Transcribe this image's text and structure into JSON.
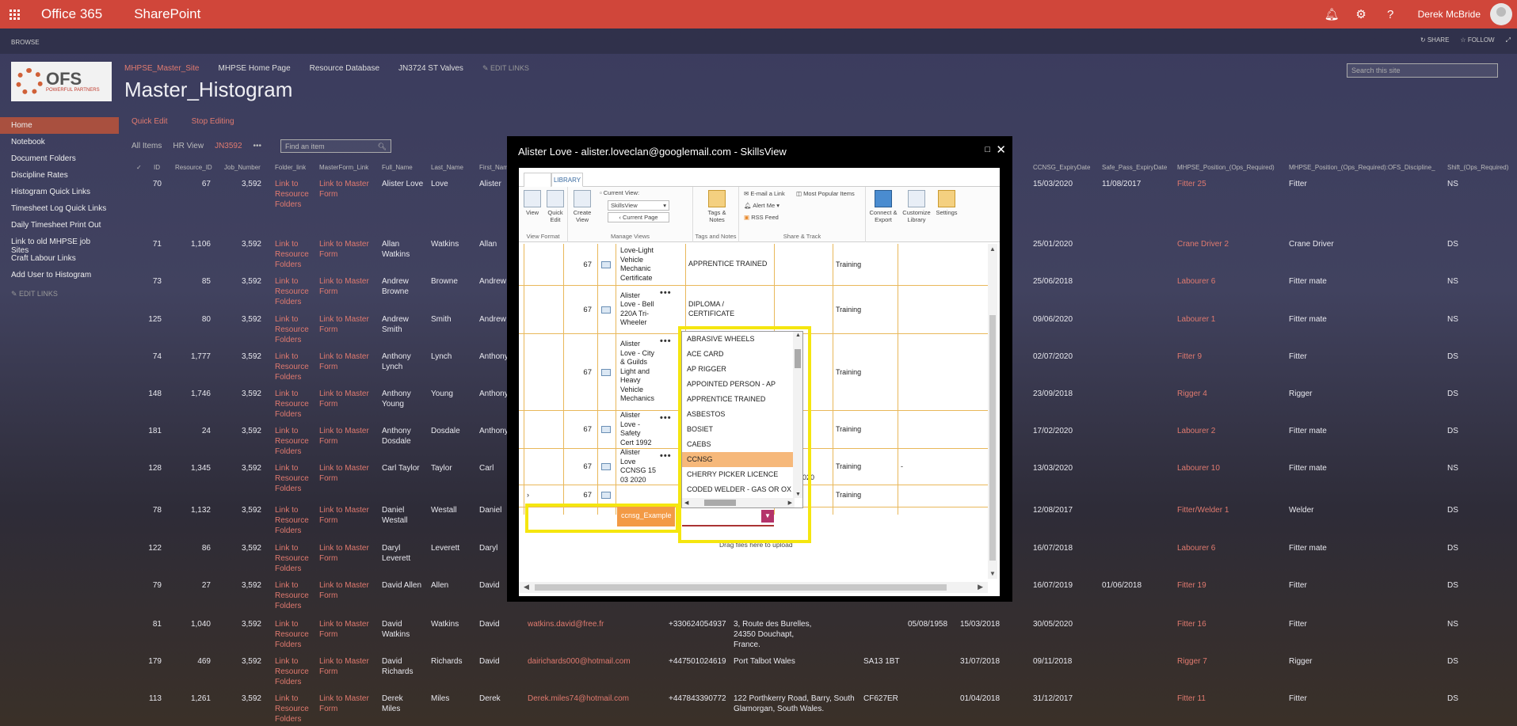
{
  "suite": {
    "brand": "Office 365",
    "app": "SharePoint",
    "user": "Derek McBride",
    "icons": [
      "bell-icon",
      "gear-icon",
      "help-icon"
    ],
    "accent": "#d0463a"
  },
  "ribbonbar": {
    "browse": "BROWSE",
    "share": "SHARE",
    "follow": "FOLLOW"
  },
  "logo": {
    "big": "OFS",
    "small": "POWERFUL PARTNERS"
  },
  "topnav": {
    "items": [
      "MHPSE_Master_Site",
      "MHPSE Home Page",
      "Resource Database",
      "JN3724 ST Valves"
    ],
    "edit_links": "EDIT LINKS"
  },
  "page_title": "Master_Histogram",
  "search": {
    "placeholder": "Search this site"
  },
  "quicklaunch": {
    "items": [
      "Home",
      "Notebook",
      "Document Folders",
      "Discipline Rates",
      "Histogram Quick Links",
      "Timesheet Log Quick Links",
      "Daily Timesheet Print Out",
      "Link to old MHPSE job Sites",
      "Craft Labour Links",
      "Add User to Histogram"
    ],
    "edit_links": "EDIT LINKS"
  },
  "commands": {
    "quick_edit": "Quick Edit",
    "stop_editing": "Stop Editing"
  },
  "views": {
    "all": "All Items",
    "hr": "HR View",
    "current": "JN3592",
    "more": "•••",
    "find_placeholder": "Find an item"
  },
  "columns": {
    "check": "✓",
    "id": "ID",
    "resource_id": "Resource_ID",
    "job_number": "Job_Number",
    "folder_link": "Folder_link",
    "masterform_link": "MasterForm_Link",
    "full_name": "Full_Name",
    "last_name": "Last_Name",
    "first_name": "First_Nam",
    "ccnsg_expiry": "CCNSG_ExpiryDate",
    "safe_pass_expiry": "Safe_Pass_ExpiryDate",
    "position_ops": "MHPSE_Position_(Ops_Required)",
    "position_disc": "MHPSE_Position_(Ops_Required):OFS_Discipline_",
    "shift": "Shift_(Ops_Required)"
  },
  "rows": [
    {
      "id": "70",
      "res": "67",
      "job": "3,592",
      "folder": [
        "Link to",
        "Resource",
        "Folders"
      ],
      "master": [
        "Link to Master",
        "Form"
      ],
      "full": [
        "Alister Love"
      ],
      "last": "Love",
      "first": "Alister",
      "email": "",
      "phone": "",
      "addr": [],
      "post": "",
      "dob": "",
      "cscs": "",
      "ccnsg": "15/03/2020",
      "safe": "11/08/2017",
      "pos": "Fitter 25",
      "disc": "Fitter",
      "shift": "NS"
    },
    {
      "id": "71",
      "res": "1,106",
      "job": "3,592",
      "folder": [
        "Link to",
        "Resource",
        "Folders"
      ],
      "master": [
        "Link to Master",
        "Form"
      ],
      "full": [
        "Allan",
        "Watkins"
      ],
      "last": "Watkins",
      "first": "Allan",
      "email": "",
      "phone": "",
      "addr": [],
      "post": "",
      "dob": "",
      "cscs": "",
      "ccnsg": "25/01/2020",
      "safe": "",
      "pos": "Crane Driver 2",
      "disc": "Crane Driver",
      "shift": "DS"
    },
    {
      "id": "73",
      "res": "85",
      "job": "3,592",
      "folder": [
        "Link to",
        "Resource",
        "Folders"
      ],
      "master": [
        "Link to Master",
        "Form"
      ],
      "full": [
        "Andrew",
        "Browne"
      ],
      "last": "Browne",
      "first": "Andrew",
      "email": "",
      "phone": "",
      "addr": [],
      "post": "",
      "dob": "",
      "cscs": "",
      "ccnsg": "25/06/2018",
      "safe": "",
      "pos": "Labourer 6",
      "disc": "Fitter mate",
      "shift": "NS"
    },
    {
      "id": "125",
      "res": "80",
      "job": "3,592",
      "folder": [
        "Link to",
        "Resource",
        "Folders"
      ],
      "master": [
        "Link to Master",
        "Form"
      ],
      "full": [
        "Andrew",
        "Smith"
      ],
      "last": "Smith",
      "first": "Andrew",
      "email": "",
      "phone": "",
      "addr": [],
      "post": "",
      "dob": "",
      "cscs": "",
      "ccnsg": "09/06/2020",
      "safe": "",
      "pos": "Labourer 1",
      "disc": "Fitter mate",
      "shift": "NS"
    },
    {
      "id": "74",
      "res": "1,777",
      "job": "3,592",
      "folder": [
        "Link to",
        "Resource",
        "Folders"
      ],
      "master": [
        "Link to Master",
        "Form"
      ],
      "full": [
        "Anthony",
        "Lynch"
      ],
      "last": "Lynch",
      "first": "Anthony",
      "email": "",
      "phone": "",
      "addr": [],
      "post": "",
      "dob": "",
      "cscs": "",
      "ccnsg": "02/07/2020",
      "safe": "",
      "pos": "Fitter 9",
      "disc": "Fitter",
      "shift": "DS"
    },
    {
      "id": "148",
      "res": "1,746",
      "job": "3,592",
      "folder": [
        "Link to",
        "Resource",
        "Folders"
      ],
      "master": [
        "Link to Master",
        "Form"
      ],
      "full": [
        "Anthony",
        "Young"
      ],
      "last": "Young",
      "first": "Anthony",
      "email": "",
      "phone": "",
      "addr": [],
      "post": "",
      "dob": "",
      "cscs": "",
      "ccnsg": "23/09/2018",
      "safe": "",
      "pos": "Rigger 4",
      "disc": "Rigger",
      "shift": "DS"
    },
    {
      "id": "181",
      "res": "24",
      "job": "3,592",
      "folder": [
        "Link to",
        "Resource",
        "Folders"
      ],
      "master": [
        "Link to Master",
        "Form"
      ],
      "full": [
        "Anthony",
        "Dosdale"
      ],
      "last": "Dosdale",
      "first": "Anthony",
      "email": "",
      "phone": "",
      "addr": [],
      "post": "",
      "dob": "",
      "cscs": "",
      "ccnsg": "17/02/2020",
      "safe": "",
      "pos": "Labourer 2",
      "disc": "Fitter mate",
      "shift": "DS"
    },
    {
      "id": "128",
      "res": "1,345",
      "job": "3,592",
      "folder": [
        "Link to",
        "Resource",
        "Folders"
      ],
      "master": [
        "Link to Master",
        "Form"
      ],
      "full": [
        "Carl Taylor"
      ],
      "last": "Taylor",
      "first": "Carl",
      "email": "",
      "phone": "",
      "addr": [],
      "post": "",
      "dob": "",
      "cscs": "",
      "ccnsg": "13/03/2020",
      "safe": "",
      "pos": "Labourer 10",
      "disc": "Fitter mate",
      "shift": "NS"
    },
    {
      "id": "78",
      "res": "1,132",
      "job": "3,592",
      "folder": [
        "Link to",
        "Resource",
        "Folders"
      ],
      "master": [
        "Link to Master",
        "Form"
      ],
      "full": [
        "Daniel",
        "Westall"
      ],
      "last": "Westall",
      "first": "Daniel",
      "email": "",
      "phone": "",
      "addr": [],
      "post": "",
      "dob": "",
      "cscs": "",
      "ccnsg": "12/08/2017",
      "safe": "",
      "pos": "Fitter/Welder 1",
      "disc": "Welder",
      "shift": "DS"
    },
    {
      "id": "122",
      "res": "86",
      "job": "3,592",
      "folder": [
        "Link to",
        "Resource",
        "Folders"
      ],
      "master": [
        "Link to Master",
        "Form"
      ],
      "full": [
        "Daryl",
        "Leverett"
      ],
      "last": "Leverett",
      "first": "Daryl",
      "email": "",
      "phone": "",
      "addr": [],
      "post": "",
      "dob": "",
      "cscs": "",
      "ccnsg": "16/07/2018",
      "safe": "",
      "pos": "Labourer 6",
      "disc": "Fitter mate",
      "shift": "DS"
    },
    {
      "id": "79",
      "res": "27",
      "job": "3,592",
      "folder": [
        "Link to",
        "Resource",
        "Folders"
      ],
      "master": [
        "Link to Master",
        "Form"
      ],
      "full": [
        "David Allen"
      ],
      "last": "Allen",
      "first": "David",
      "email": "",
      "phone": "",
      "addr": [],
      "post": "",
      "dob": "",
      "cscs": "",
      "ccnsg": "16/07/2019",
      "safe": "01/06/2018",
      "pos": "Fitter 19",
      "disc": "Fitter",
      "shift": "DS"
    },
    {
      "id": "81",
      "res": "1,040",
      "job": "3,592",
      "folder": [
        "Link to",
        "Resource",
        "Folders"
      ],
      "master": [
        "Link to Master",
        "Form"
      ],
      "full": [
        "David",
        "Watkins"
      ],
      "last": "Watkins",
      "first": "David",
      "email": "watkins.david@free.fr",
      "phone": "+330624054937",
      "addr": [
        "3, Route des Burelles,",
        "24350 Douchapt,",
        "France."
      ],
      "post": "",
      "dob": "05/08/1958",
      "cscs": "15/03/2018",
      "ccnsg": "30/05/2020",
      "safe": "",
      "pos": "Fitter 16",
      "disc": "Fitter",
      "shift": "NS"
    },
    {
      "id": "179",
      "res": "469",
      "job": "3,592",
      "folder": [
        "Link to",
        "Resource",
        "Folders"
      ],
      "master": [
        "Link to Master",
        "Form"
      ],
      "full": [
        "David",
        "Richards"
      ],
      "last": "Richards",
      "first": "David",
      "email": "dairichards000@hotmail.com",
      "phone": "+447501024619",
      "addr": [
        "Port Talbot Wales"
      ],
      "post": "SA13 1BT",
      "dob": "",
      "cscs": "31/07/2018",
      "ccnsg": "09/11/2018",
      "safe": "",
      "pos": "Rigger 7",
      "disc": "Rigger",
      "shift": "DS"
    },
    {
      "id": "113",
      "res": "1,261",
      "job": "3,592",
      "folder": [
        "Link to",
        "Resource",
        "Folders"
      ],
      "master": [
        "Link to Master",
        "Form"
      ],
      "full": [
        "Derek",
        "Miles"
      ],
      "last": "Miles",
      "first": "Derek",
      "email": "Derek.miles74@hotmail.com",
      "phone": "+447843390772",
      "addr": [
        "122 Porthkerry Road, Barry, South",
        "Glamorgan, South Wales."
      ],
      "post": "CF627ER",
      "dob": "",
      "cscs": "01/04/2018",
      "ccnsg": "31/12/2017",
      "safe": "",
      "pos": "Fitter 11",
      "disc": "Fitter",
      "shift": "DS"
    }
  ],
  "modal": {
    "title": "Alister Love - alister.loveclan@googlemail.com - SkillsView",
    "tab": "LIBRARY",
    "ribbon": {
      "view": "View",
      "quick_edit": [
        "Quick",
        "Edit"
      ],
      "view_format": "View Format",
      "create_view": [
        "Create",
        "View"
      ],
      "current_view": "Current View:",
      "view_select": "SkillsView",
      "current_page": "Current Page",
      "manage_views": "Manage Views",
      "tags_notes": [
        "Tags &",
        "Notes"
      ],
      "tags_group": "Tags and Notes",
      "email_link": "E-mail a Link",
      "alert_me": "Alert Me",
      "rss": "RSS Feed",
      "popular": "Most Popular Items",
      "share_group": "Share & Track",
      "connect": [
        "Connect &",
        "Export"
      ],
      "customize": [
        "Customize",
        "Library"
      ],
      "settings": "Settings"
    },
    "grid_rows": [
      {
        "num": "67",
        "name": [
          "Love-Light",
          "Vehicle",
          "Mechanic",
          "Certificate"
        ],
        "qual": [
          "APPRENTICE TRAINED"
        ],
        "type": "Training",
        "extra": ""
      },
      {
        "num": "67",
        "name": [
          "Alister",
          "Love - Bell",
          "220A Tri-",
          "Wheeler"
        ],
        "qual": [
          "DIPLOMA /",
          "CERTIFICATE"
        ],
        "type": "Training",
        "extra": ""
      },
      {
        "num": "67",
        "name": [
          "Alister",
          "Love - City",
          "& Guilds",
          "Light and",
          "Heavy",
          "Vehicle",
          "Mechanics"
        ],
        "qual": [],
        "type": "Training",
        "extra": ""
      },
      {
        "num": "67",
        "name": [
          "Alister",
          "Love -",
          "Safety",
          "Cert 1992"
        ],
        "qual": [],
        "type": "Training",
        "extra": ""
      },
      {
        "num": "67",
        "name": [
          "Alister",
          "Love",
          "CCNSG 15",
          "03 2020"
        ],
        "qual": [],
        "type": "Training",
        "extra": "-"
      }
    ],
    "partial_date": "020",
    "edit_row": {
      "num": "67",
      "name": "ccnsg_Example",
      "type": "Training"
    },
    "dropdown": [
      "ABRASIVE WHEELS",
      "ACE CARD",
      "AP RIGGER",
      "APPOINTED PERSON - AP",
      "APPRENTICE TRAINED",
      "ASBESTOS",
      "BOSIET",
      "CAEBS",
      "CCNSG",
      "CHERRY PICKER LICENCE",
      "CODED WELDER - GAS OR OX"
    ],
    "dropdown_selected": "CCNSG",
    "drag_text": "Drag files here to upload",
    "highlight_color": "#f5e60f"
  }
}
